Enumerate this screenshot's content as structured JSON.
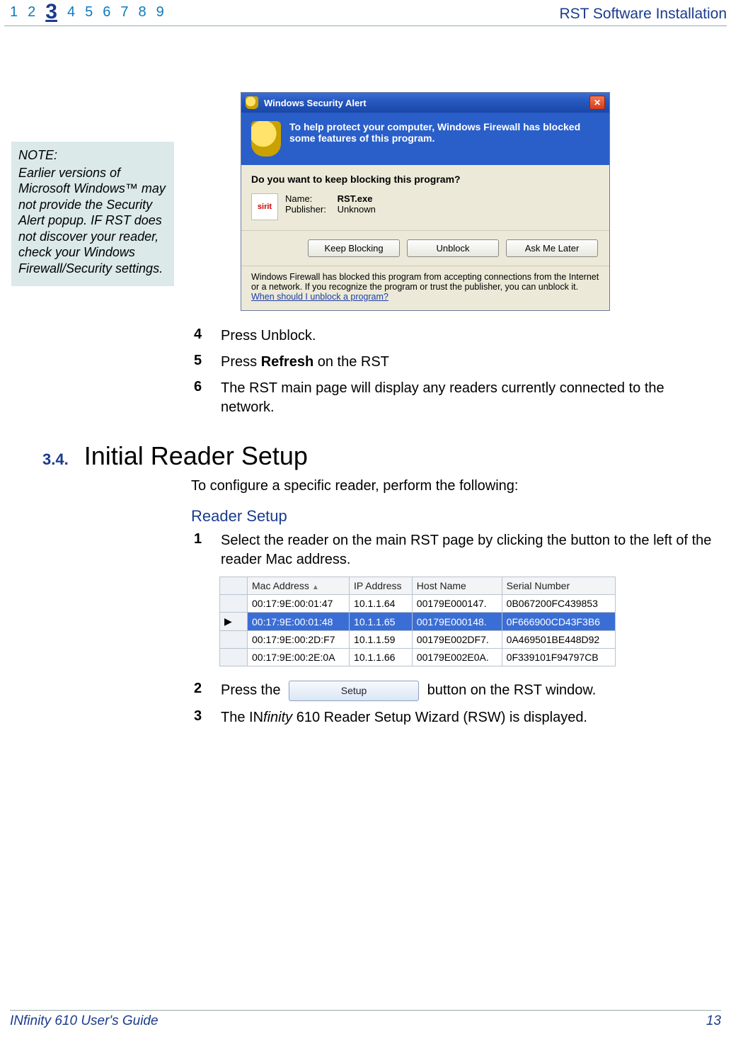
{
  "header": {
    "chapters": [
      "1",
      "2",
      "3",
      "4",
      "5",
      "6",
      "7",
      "8",
      "9"
    ],
    "current_chapter": "3",
    "title": "RST Software Installation"
  },
  "note": {
    "title": "NOTE:",
    "body": "Earlier versions of Microsoft Windows™ may not provide the Security Alert popup. IF RST does not discover your reader, check your Windows Firewall/Security settings."
  },
  "dialog": {
    "titlebar": "Windows Security Alert",
    "banner": "To help protect your computer, Windows Firewall has blocked some features of this program.",
    "question": "Do you want to keep blocking this program?",
    "icon_text": "sirit",
    "name_label": "Name:",
    "name_value": "RST.exe",
    "publisher_label": "Publisher:",
    "publisher_value": "Unknown",
    "buttons": {
      "keep": "Keep Blocking",
      "unblock": "Unblock",
      "later": "Ask Me Later"
    },
    "footer_text": "Windows Firewall has blocked this program from accepting connections from the Internet or a network. If you recognize the program or trust the publisher, you can unblock it. ",
    "footer_link": "When should I unblock a program?"
  },
  "steps_top": [
    {
      "num": "4",
      "text": "Press Unblock."
    },
    {
      "num": "5",
      "text_parts": [
        "Press ",
        "Refresh",
        " on the RST"
      ]
    },
    {
      "num": "6",
      "text": "The RST main page will display any readers currently connected to the network."
    }
  ],
  "section": {
    "num": "3.4.",
    "title": "Initial Reader Setup",
    "intro": "To configure a specific reader, perform the following:",
    "subhead": "Reader Setup"
  },
  "steps_bottom": {
    "s1": {
      "num": "1",
      "text": "Select the reader on the main RST page by clicking the button to the left of the reader Mac address."
    },
    "s2": {
      "num": "2",
      "pre": "Press the ",
      "button": "Setup",
      "post": " button on the RST window."
    },
    "s3": {
      "num": "3",
      "pre": "The IN",
      "italic": "finity",
      "post": " 610 Reader Setup Wizard (RSW) is displayed."
    }
  },
  "readers_table": {
    "headers": {
      "mac": "Mac Address",
      "ip": "IP Address",
      "host": "Host Name",
      "serial": "Serial Number"
    },
    "rows": [
      {
        "mac": "00:17:9E:00:01:47",
        "ip": "10.1.1.64",
        "host": "00179E000147.",
        "serial": "0B067200FC439853",
        "selected": false
      },
      {
        "mac": "00:17:9E:00:01:48",
        "ip": "10.1.1.65",
        "host": "00179E000148.",
        "serial": "0F666900CD43F3B6",
        "selected": true
      },
      {
        "mac": "00:17:9E:00:2D:F7",
        "ip": "10.1.1.59",
        "host": "00179E002DF7.",
        "serial": "0A469501BE448D92",
        "selected": false
      },
      {
        "mac": "00:17:9E:00:2E:0A",
        "ip": "10.1.1.66",
        "host": "00179E002E0A.",
        "serial": "0F339101F94797CB",
        "selected": false
      }
    ]
  },
  "footer": {
    "left_prefix": "IN",
    "left_italic": "finity",
    "left_suffix": " 610 User's Guide",
    "page": "13"
  }
}
